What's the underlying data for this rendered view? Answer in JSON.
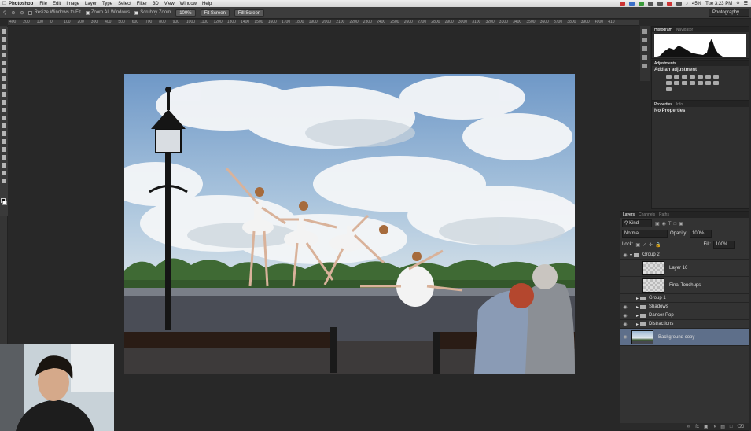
{
  "menubar": {
    "app_name": "Photoshop",
    "items": [
      "File",
      "Edit",
      "Image",
      "Layer",
      "Type",
      "Select",
      "Filter",
      "3D",
      "View",
      "Window",
      "Help"
    ],
    "clock": "Tue 3:23 PM",
    "battery": "45%"
  },
  "options": {
    "resize_windows": "Resize Windows to Fit",
    "zoom_all": "Zoom All Windows",
    "scrubby_zoom": "Scrubby Zoom",
    "btn_100": "100%",
    "btn_fit": "Fit Screen",
    "btn_fill": "Fill Screen",
    "workspace": "Photography"
  },
  "ruler": {
    "ticks": [
      "400",
      "200",
      "100",
      "0",
      "100",
      "200",
      "300",
      "400",
      "500",
      "600",
      "700",
      "800",
      "900",
      "1000",
      "1100",
      "1200",
      "1300",
      "1400",
      "1500",
      "1600",
      "1700",
      "1800",
      "1900",
      "2000",
      "2100",
      "2200",
      "2300",
      "2400",
      "2500",
      "2600",
      "2700",
      "2800",
      "2900",
      "3000",
      "3100",
      "3200",
      "3300",
      "3400",
      "3500",
      "3600",
      "3700",
      "3800",
      "3900",
      "4000",
      "410"
    ]
  },
  "histogram": {
    "tab1": "Histogram",
    "tab2": "Navigator"
  },
  "adjustments": {
    "tab": "Adjustments",
    "title": "Add an adjustment"
  },
  "properties": {
    "tab1": "Properties",
    "tab2": "Info",
    "title": "No Properties"
  },
  "layers": {
    "tabs": [
      "Layers",
      "Channels",
      "Paths"
    ],
    "filter": "Kind",
    "blend_mode": "Normal",
    "opacity_label": "Opacity:",
    "opacity": "100%",
    "lock_label": "Lock:",
    "fill_label": "Fill:",
    "fill": "100%",
    "rows": [
      {
        "name": "Group 2",
        "kind": "group-open",
        "visible": true
      },
      {
        "name": "Layer 16",
        "kind": "layer-thumb",
        "visible": false
      },
      {
        "name": "Final Touchups",
        "kind": "layer-thumb",
        "visible": false
      },
      {
        "name": "Group 1",
        "kind": "group",
        "visible": false
      },
      {
        "name": "Shadows",
        "kind": "group",
        "visible": true
      },
      {
        "name": "Dancer Pop",
        "kind": "group",
        "visible": true
      },
      {
        "name": "Distractions",
        "kind": "group",
        "visible": true
      },
      {
        "name": "Background copy",
        "kind": "background",
        "visible": true,
        "selected": true
      }
    ],
    "footer_icons": [
      "link-icon",
      "fx-icon",
      "mask-icon",
      "adjustment-icon",
      "folder-icon",
      "new-layer-icon",
      "trash-icon"
    ]
  },
  "colors": {
    "selection": "#5e6f8a",
    "panel_bg": "#333333",
    "canvas_bg": "#282828"
  }
}
